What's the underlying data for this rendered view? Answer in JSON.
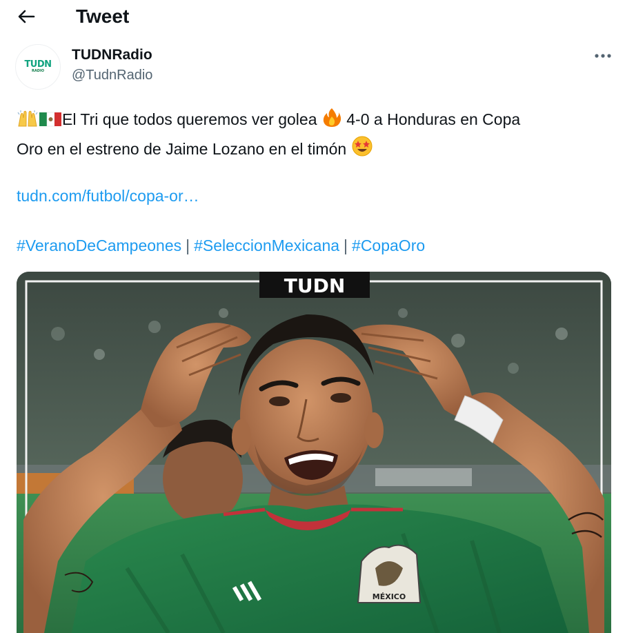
{
  "header": {
    "title": "Tweet",
    "back_icon": "arrow-left-icon"
  },
  "author": {
    "avatar_text": "TUDN",
    "avatar_subtext": "RADIO",
    "display_name": "TUDNRadio",
    "handle": "@TudnRadio",
    "more_icon": "more-horizontal-icon"
  },
  "tweet": {
    "line1_text_a": "El Tri que todos queremos ver golea ",
    "line1_text_b": " 4-0 a Honduras en Copa",
    "line2_text": "Oro en el estreno de Jaime Lozano en el timón ",
    "link": "tudn.com/futbol/copa-or…",
    "hashtags": [
      "#VeranoDeCampeones",
      "#SeleccionMexicana",
      "#CopaOro"
    ],
    "separator": "|",
    "emojis": [
      "raising-hands-emoji",
      "mexico-flag-emoji",
      "fire-emoji",
      "star-struck-emoji"
    ]
  },
  "media": {
    "watermark": "TUDN",
    "crest_text": "MÉXICO",
    "colors": {
      "jersey": "#1f7a43",
      "pitch": "#2f8a4a",
      "skin": "#b97a55"
    }
  },
  "colors": {
    "link": "#1d9bf0",
    "text": "#0f1419",
    "muted": "#536471"
  }
}
